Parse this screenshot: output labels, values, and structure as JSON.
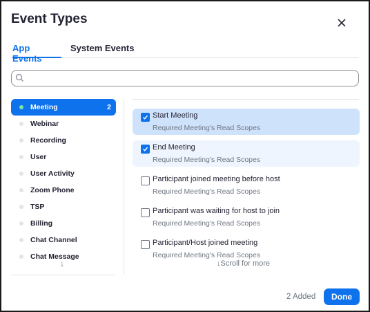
{
  "dialog": {
    "title": "Event Types"
  },
  "tabs": [
    {
      "label": "App Events",
      "active": true
    },
    {
      "label": "System Events",
      "active": false
    }
  ],
  "search": {
    "value": "",
    "placeholder": ""
  },
  "categories": [
    {
      "label": "Meeting",
      "count": "2",
      "selected": true
    },
    {
      "label": "Webinar",
      "count": ""
    },
    {
      "label": "Recording",
      "count": ""
    },
    {
      "label": "User",
      "count": ""
    },
    {
      "label": "User Activity",
      "count": ""
    },
    {
      "label": "Zoom Phone",
      "count": ""
    },
    {
      "label": "TSP",
      "count": ""
    },
    {
      "label": "Billing",
      "count": ""
    },
    {
      "label": "Chat Channel",
      "count": ""
    },
    {
      "label": "Chat Message",
      "count": ""
    }
  ],
  "category_scroll_hint": "↓",
  "events": [
    {
      "name": "Start Meeting",
      "scope": "Required Meeting's Read Scopes",
      "checked": true
    },
    {
      "name": "End Meeting",
      "scope": "Required Meeting's Read Scopes",
      "checked": true
    },
    {
      "name": "Participant joined meeting before host",
      "scope": "Required Meeting's Read Scopes",
      "checked": false
    },
    {
      "name": "Participant was waiting for host to join",
      "scope": "Required Meeting's Read Scopes",
      "checked": false
    },
    {
      "name": "Participant/Host joined meeting",
      "scope": "Required Meeting's Read Scopes",
      "checked": false
    }
  ],
  "events_scroll_hint": "↓Scroll for more",
  "footer": {
    "added_label": "2 Added",
    "done_label": "Done"
  },
  "colors": {
    "accent": "#0e72ed",
    "selected_row_bg": "#cfe2fb",
    "checked_row_bg": "#eef5fe",
    "status_dot": "#7fe3a5"
  }
}
